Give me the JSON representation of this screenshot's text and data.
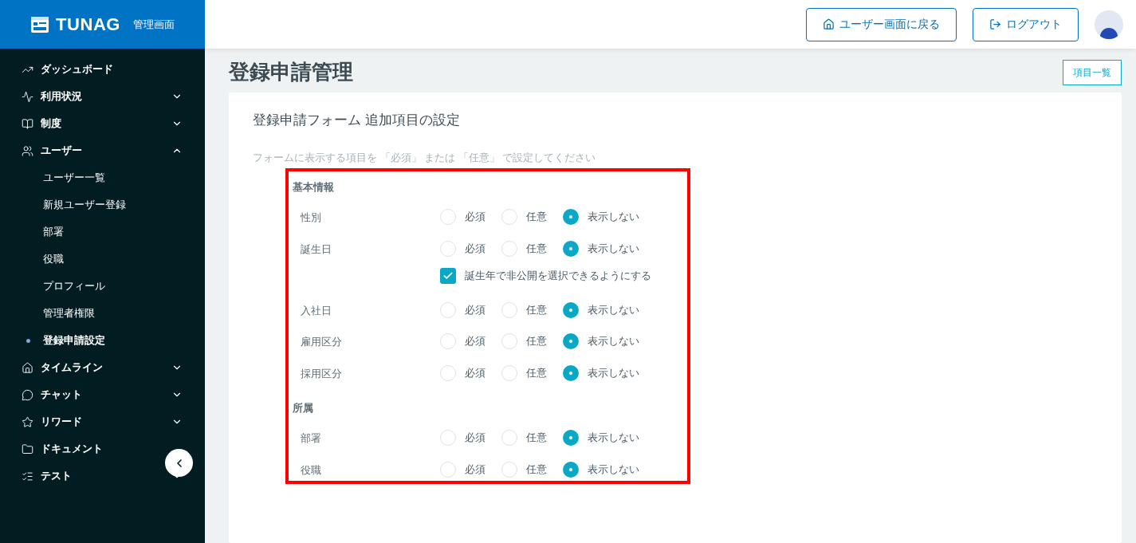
{
  "sidebar": {
    "logo": "TUNAG",
    "logo_sub": "管理画面",
    "items": [
      {
        "label": "ダッシュボード"
      },
      {
        "label": "利用状況",
        "expanded": false
      },
      {
        "label": "制度",
        "expanded": false
      },
      {
        "label": "ユーザー",
        "expanded": true,
        "children": [
          {
            "label": "ユーザー一覧",
            "selected": false
          },
          {
            "label": "新規ユーザー登録",
            "selected": false
          },
          {
            "label": "部署",
            "selected": false
          },
          {
            "label": "役職",
            "selected": false
          },
          {
            "label": "プロフィール",
            "selected": false
          },
          {
            "label": "管理者権限",
            "selected": false
          },
          {
            "label": "登録申請設定",
            "selected": true
          }
        ]
      },
      {
        "label": "タイムライン",
        "expanded": false
      },
      {
        "label": "チャット",
        "expanded": false
      },
      {
        "label": "リワード",
        "expanded": false
      },
      {
        "label": "ドキュメント"
      },
      {
        "label": "テスト",
        "expanded": false
      }
    ]
  },
  "header": {
    "buttons": [
      "ユーザー画面に戻る",
      "ログアウト"
    ]
  },
  "page": {
    "title": "登録申請管理",
    "list_button": "項目一覧"
  },
  "card": {
    "title": "登録申請フォーム 追加項目の設定",
    "instruction": "フォームに表示する項目を 「必須」 または 「任意」 で設定してください",
    "sections": [
      {
        "heading": "基本情報",
        "fields": [
          {
            "label": "性別",
            "options": [
              {
                "label": "必須",
                "selected": false
              },
              {
                "label": "任意",
                "selected": false
              },
              {
                "label": "表示しない",
                "selected": true
              }
            ]
          },
          {
            "label": "誕生日",
            "options": [
              {
                "label": "必須",
                "selected": false
              },
              {
                "label": "任意",
                "selected": false
              },
              {
                "label": "表示しない",
                "selected": true
              }
            ],
            "checkbox": {
              "label": "誕生年で非公開を選択できるようにする",
              "checked": true
            }
          },
          {
            "label": "入社日",
            "options": [
              {
                "label": "必須",
                "selected": false
              },
              {
                "label": "任意",
                "selected": false
              },
              {
                "label": "表示しない",
                "selected": true
              }
            ]
          },
          {
            "label": "雇用区分",
            "options": [
              {
                "label": "必須",
                "selected": false
              },
              {
                "label": "任意",
                "selected": false
              },
              {
                "label": "表示しない",
                "selected": true
              }
            ]
          },
          {
            "label": "採用区分",
            "options": [
              {
                "label": "必須",
                "selected": false
              },
              {
                "label": "任意",
                "selected": false
              },
              {
                "label": "表示しない",
                "selected": true
              }
            ]
          }
        ]
      },
      {
        "heading": "所属",
        "fields": [
          {
            "label": "部署",
            "options": [
              {
                "label": "必須",
                "selected": false
              },
              {
                "label": "任意",
                "selected": false
              },
              {
                "label": "表示しない",
                "selected": true
              }
            ]
          },
          {
            "label": "役職",
            "options": [
              {
                "label": "必須",
                "selected": false
              },
              {
                "label": "任意",
                "selected": false
              },
              {
                "label": "表示しない",
                "selected": true
              }
            ]
          }
        ]
      }
    ]
  }
}
